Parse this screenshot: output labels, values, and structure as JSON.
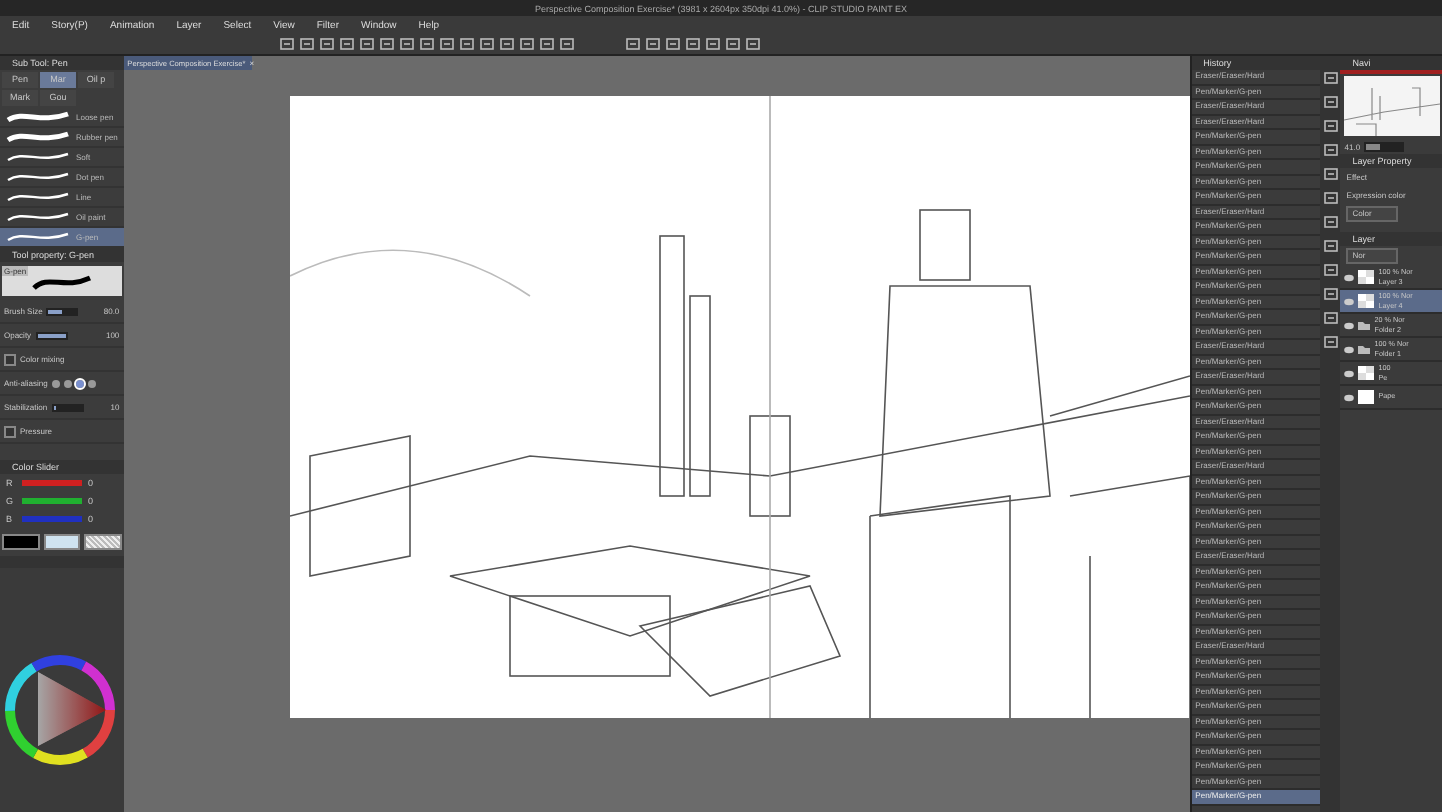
{
  "window": {
    "title": "Perspective Composition Exercise* (3981 x 2604px 350dpi 41.0%) - CLIP STUDIO PAINT EX"
  },
  "menu": [
    "Edit",
    "Story(P)",
    "Animation",
    "Layer",
    "Select",
    "View",
    "Filter",
    "Window",
    "Help"
  ],
  "document_tab": {
    "label": "Perspective Composition Exercise*",
    "close": "×"
  },
  "sub_tool": {
    "title": "Sub Tool: Pen",
    "groups": [
      {
        "label": "Pen",
        "selected": false
      },
      {
        "label": "Mar",
        "selected": true
      },
      {
        "label": "Oil p",
        "selected": false
      },
      {
        "label": "Mark",
        "selected": false
      },
      {
        "label": "Gou",
        "selected": false
      }
    ],
    "brushes": [
      {
        "label": "Loose pen",
        "selected": false
      },
      {
        "label": "Rubber pen",
        "selected": false
      },
      {
        "label": "Soft",
        "selected": false
      },
      {
        "label": "Dot pen",
        "selected": false
      },
      {
        "label": "Line",
        "selected": false
      },
      {
        "label": "Oil paint",
        "selected": false
      },
      {
        "label": "G-pen",
        "selected": true
      }
    ]
  },
  "tool_property": {
    "title": "Tool property: G-pen",
    "preview_label": "G-pen",
    "rows": [
      {
        "kind": "slider",
        "label": "Brush Size",
        "value": "80.0",
        "level": 0.45
      },
      {
        "kind": "slider",
        "label": "Opacity",
        "value": "100",
        "level": 1
      },
      {
        "kind": "checkbox",
        "label": "Color mixing",
        "checked": false
      },
      {
        "kind": "choice",
        "label": "Anti-aliasing",
        "options": [
          {
            "selected": false
          },
          {
            "selected": false
          },
          {
            "selected": true
          },
          {
            "selected": false
          }
        ]
      },
      {
        "kind": "slider",
        "label": "Stabilization",
        "value": "10",
        "level": 0.1
      },
      {
        "kind": "checkbox",
        "label": "Pressure",
        "checked": false
      }
    ]
  },
  "color_slider": {
    "title": "Color Slider",
    "channels": [
      {
        "name": "R",
        "value": "0",
        "color": "#d02020"
      },
      {
        "name": "G",
        "value": "0",
        "color": "#20b030"
      },
      {
        "name": "B",
        "value": "0",
        "color": "#2030c0"
      }
    ]
  },
  "history": {
    "title": "History",
    "entries": [
      {
        "label": "Eraser/Eraser/Hard",
        "selected": false
      },
      {
        "label": "Pen/Marker/G-pen",
        "selected": false
      },
      {
        "label": "Eraser/Eraser/Hard",
        "selected": false
      },
      {
        "label": "Eraser/Eraser/Hard",
        "selected": false
      },
      {
        "label": "Pen/Marker/G-pen",
        "selected": false
      },
      {
        "label": "Pen/Marker/G-pen",
        "selected": false
      },
      {
        "label": "Pen/Marker/G-pen",
        "selected": false
      },
      {
        "label": "Pen/Marker/G-pen",
        "selected": false
      },
      {
        "label": "Pen/Marker/G-pen",
        "selected": false
      },
      {
        "label": "Eraser/Eraser/Hard",
        "selected": false
      },
      {
        "label": "Pen/Marker/G-pen",
        "selected": false
      },
      {
        "label": "Pen/Marker/G-pen",
        "selected": false
      },
      {
        "label": "Pen/Marker/G-pen",
        "selected": false
      },
      {
        "label": "Pen/Marker/G-pen",
        "selected": false
      },
      {
        "label": "Pen/Marker/G-pen",
        "selected": false
      },
      {
        "label": "Pen/Marker/G-pen",
        "selected": false
      },
      {
        "label": "Pen/Marker/G-pen",
        "selected": false
      },
      {
        "label": "Pen/Marker/G-pen",
        "selected": false
      },
      {
        "label": "Eraser/Eraser/Hard",
        "selected": false
      },
      {
        "label": "Pen/Marker/G-pen",
        "selected": false
      },
      {
        "label": "Eraser/Eraser/Hard",
        "selected": false
      },
      {
        "label": "Pen/Marker/G-pen",
        "selected": false
      },
      {
        "label": "Pen/Marker/G-pen",
        "selected": false
      },
      {
        "label": "Eraser/Eraser/Hard",
        "selected": false
      },
      {
        "label": "Pen/Marker/G-pen",
        "selected": false
      },
      {
        "label": "Pen/Marker/G-pen",
        "selected": false
      },
      {
        "label": "Eraser/Eraser/Hard",
        "selected": false
      },
      {
        "label": "Pen/Marker/G-pen",
        "selected": false
      },
      {
        "label": "Pen/Marker/G-pen",
        "selected": false
      },
      {
        "label": "Pen/Marker/G-pen",
        "selected": false
      },
      {
        "label": "Pen/Marker/G-pen",
        "selected": false
      },
      {
        "label": "Pen/Marker/G-pen",
        "selected": false
      },
      {
        "label": "Eraser/Eraser/Hard",
        "selected": false
      },
      {
        "label": "Pen/Marker/G-pen",
        "selected": false
      },
      {
        "label": "Pen/Marker/G-pen",
        "selected": false
      },
      {
        "label": "Pen/Marker/G-pen",
        "selected": false
      },
      {
        "label": "Pen/Marker/G-pen",
        "selected": false
      },
      {
        "label": "Pen/Marker/G-pen",
        "selected": false
      },
      {
        "label": "Eraser/Eraser/Hard",
        "selected": false
      },
      {
        "label": "Pen/Marker/G-pen",
        "selected": false
      },
      {
        "label": "Pen/Marker/G-pen",
        "selected": false
      },
      {
        "label": "Pen/Marker/G-pen",
        "selected": false
      },
      {
        "label": "Pen/Marker/G-pen",
        "selected": false
      },
      {
        "label": "Pen/Marker/G-pen",
        "selected": false
      },
      {
        "label": "Pen/Marker/G-pen",
        "selected": false
      },
      {
        "label": "Pen/Marker/G-pen",
        "selected": false
      },
      {
        "label": "Pen/Marker/G-pen",
        "selected": false
      },
      {
        "label": "Pen/Marker/G-pen",
        "selected": false
      },
      {
        "label": "Pen/Marker/G-pen",
        "selected": true
      }
    ]
  },
  "navigator": {
    "title": "Navi",
    "zoom": "41.0",
    "level": 0.41
  },
  "layer_property": {
    "title": "Layer Property",
    "effect_label": "Effect",
    "expression_label": "Expression color",
    "expression_value": "Color"
  },
  "layer_panel": {
    "title": "Layer",
    "blend_mode": "Nor",
    "layers": [
      {
        "kind": "layer",
        "mode": "100 % Nor",
        "name": "Layer 3",
        "selected": false
      },
      {
        "kind": "layer",
        "mode": "100 % Nor",
        "name": "Layer 4",
        "selected": true
      },
      {
        "kind": "folder",
        "mode": "20 % Nor",
        "name": "Folder 2",
        "selected": false
      },
      {
        "kind": "folder",
        "mode": "100 % Nor",
        "name": "Folder 1",
        "selected": false
      },
      {
        "kind": "layer",
        "mode": "100",
        "name": "Pe",
        "selected": false
      },
      {
        "kind": "paper",
        "name": "Pape",
        "selected": false
      }
    ]
  }
}
